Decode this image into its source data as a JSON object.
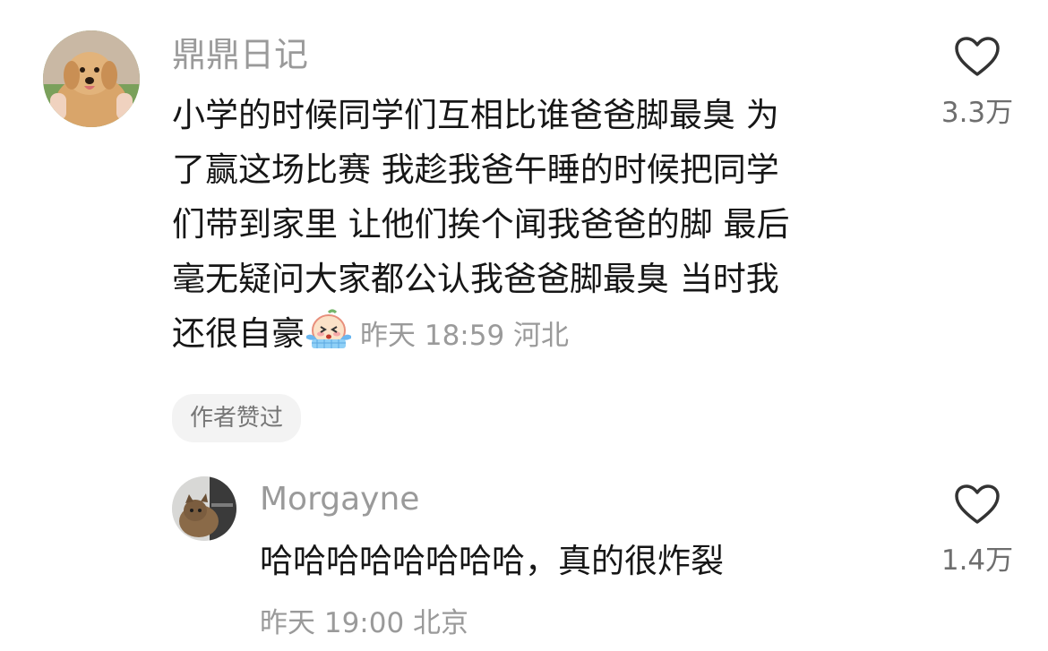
{
  "comments": [
    {
      "username": "鼎鼎日记",
      "avatar_icon": "golden-retriever-photo",
      "text": "小学的时候同学们互相比谁爸爸脚最臭 为了赢这场比赛 我趁我爸午睡的时候把同学们带到家里 让他们挨个闻我爸爸的脚 最后毫无疑问大家都公认我爸爸脚最臭 当时我还很自豪",
      "text_lines": [
        "小学的时候同学们互相比谁爸爸脚最臭 为",
        "了赢这场比赛 我趁我爸午睡的时候把同学",
        "们带到家里 让他们挨个闻我爸爸的脚 最后",
        "毫无疑问大家都公认我爸爸脚最臭 当时我",
        "还很自豪"
      ],
      "emoji_icon": "crying-face-emoji",
      "meta": "昨天 18:59 河北",
      "badge": "作者赞过",
      "like_count": "3.3万",
      "like_icon": "heart-outline-icon"
    },
    {
      "username": "Morgayne",
      "avatar_icon": "cat-photo",
      "text": "哈哈哈哈哈哈哈哈，真的很炸裂",
      "meta": "昨天 19:00 北京",
      "like_count": "1.4万",
      "like_icon": "heart-outline-icon"
    }
  ],
  "colors": {
    "text": "#161616",
    "secondary": "#9a9a9a",
    "badge_bg": "#f3f3f3"
  }
}
